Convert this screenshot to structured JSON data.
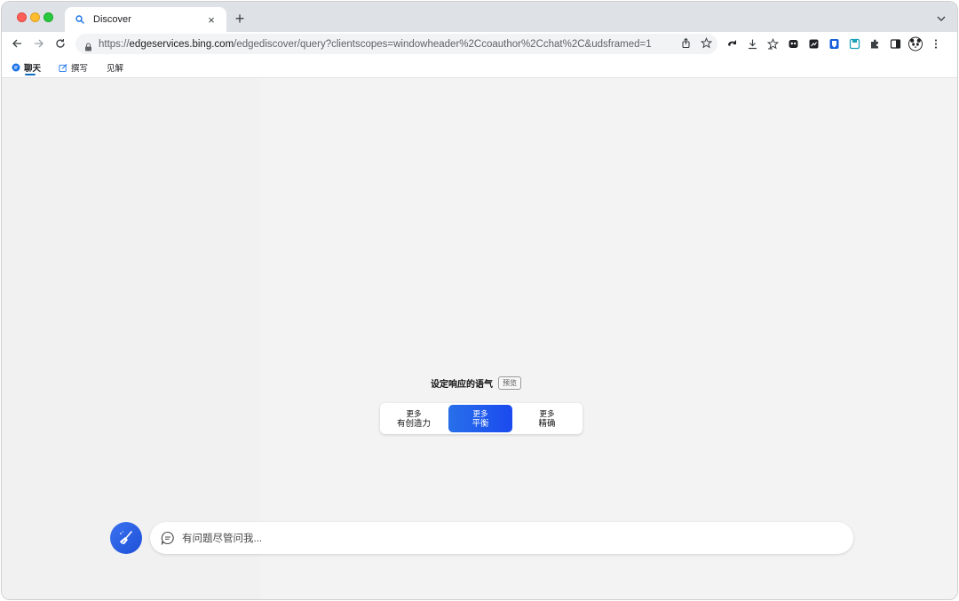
{
  "browser": {
    "tab_title": "Discover",
    "tab_close": "×",
    "new_tab": "+",
    "url_scheme": "https://",
    "url_host": "edgeservices.bing.com",
    "url_path": "/edgediscover/query?clientscopes=windowheader%2Ccoauthor%2Cchat%2C&udsframed=1"
  },
  "appnav": {
    "chat": "聊天",
    "compose": "撰写",
    "insights": "见解"
  },
  "tone": {
    "heading": "设定响应的语气",
    "badge": "预览",
    "options": [
      {
        "line1": "更多",
        "line2": "有创造力"
      },
      {
        "line1": "更多",
        "line2": "平衡"
      },
      {
        "line1": "更多",
        "line2": "精确"
      }
    ],
    "selected_color": "#2563eb"
  },
  "chat": {
    "placeholder": "有问题尽管问我..."
  }
}
